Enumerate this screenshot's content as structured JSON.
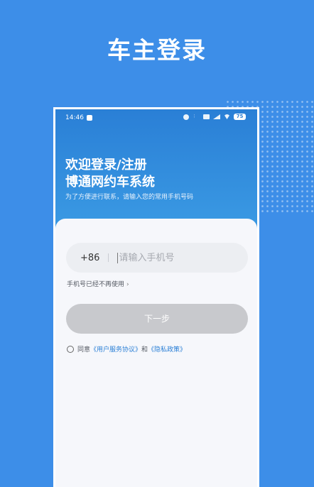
{
  "promo": {
    "title": "车主登录"
  },
  "status_bar": {
    "time": "14:46",
    "battery": "75"
  },
  "header": {
    "welcome_line1": "欢迎登录/注册",
    "welcome_line2": "博通网约车系统",
    "subtitle": "为了方便进行联系，请输入您的常用手机号码"
  },
  "form": {
    "country_code": "+86",
    "phone_placeholder": "请输入手机号",
    "phone_value": "",
    "help_link": "手机号已经不再使用",
    "next_button": "下一步",
    "agree_prefix": "同意",
    "user_agreement": "《用户服务协议》",
    "agree_and": "和",
    "privacy_policy": "《隐私政策》"
  },
  "colors": {
    "background": "#3d8ee8",
    "header_gradient_top": "#2a7fd6",
    "header_gradient_bottom": "#3b9be4",
    "link": "#2a7fd6",
    "button_disabled": "#c8c9cd"
  }
}
